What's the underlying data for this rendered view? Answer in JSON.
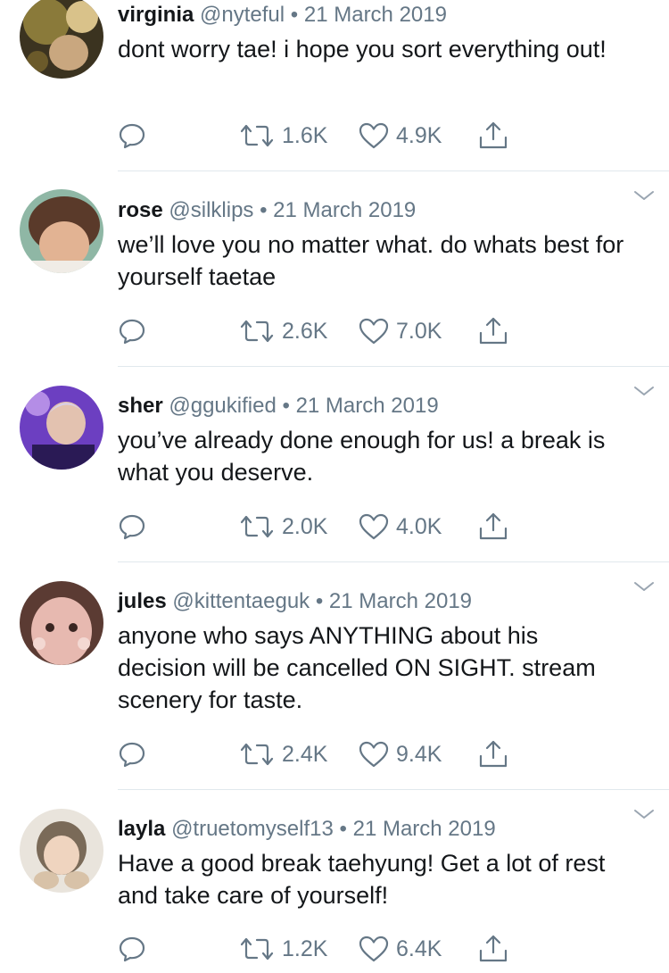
{
  "tweets": [
    {
      "name": "virginia",
      "handle": "@nyteful",
      "sep": "•",
      "date": "21 March 2019",
      "text": "dont worry tae! i hope you sort everything out!",
      "retweets": "1.6K",
      "likes": "4.9K",
      "avatar_colors": [
        "#8a7a3a",
        "#d9c28a",
        "#3b3320"
      ]
    },
    {
      "name": "rose",
      "handle": "@silklips",
      "sep": "•",
      "date": "21 March 2019",
      "text": "we’ll love you no matter what. do whats best for yourself taetae",
      "retweets": "2.6K",
      "likes": "7.0K",
      "avatar_colors": [
        "#8fb7a5",
        "#c98b6a",
        "#5a3a2a"
      ]
    },
    {
      "name": "sher",
      "handle": "@ggukified",
      "sep": "•",
      "date": "21 March 2019",
      "text": "you’ve already done enough for us! a break is what you deserve.",
      "retweets": "2.0K",
      "likes": "4.0K",
      "avatar_colors": [
        "#6c3fc1",
        "#b48de6",
        "#2a1a55"
      ]
    },
    {
      "name": "jules",
      "handle": "@kittentaeguk",
      "sep": "•",
      "date": "21 March 2019",
      "text": "anyone who says ANYTHING about his decision will be cancelled ON SIGHT. stream scenery for taste.",
      "retweets": "2.4K",
      "likes": "9.4K",
      "avatar_colors": [
        "#e7b9b0",
        "#f3d8d2",
        "#5b3b33"
      ]
    },
    {
      "name": "layla",
      "handle": "@truetomyself13",
      "sep": "•",
      "date": "21 March 2019",
      "text": "Have a good break taehyung! Get a lot of rest and take care of yourself!",
      "retweets": "1.2K",
      "likes": "6.4K",
      "avatar_colors": [
        "#e9e4dc",
        "#d8c2a8",
        "#7a6a58"
      ]
    }
  ],
  "icons": {
    "reply": "reply-icon",
    "retweet": "retweet-icon",
    "like": "heart-icon",
    "share": "share-icon",
    "more": "chevron-down-icon"
  },
  "colors": {
    "text": "#14171a",
    "secondary": "#657786",
    "divider": "#e1e8ed"
  }
}
